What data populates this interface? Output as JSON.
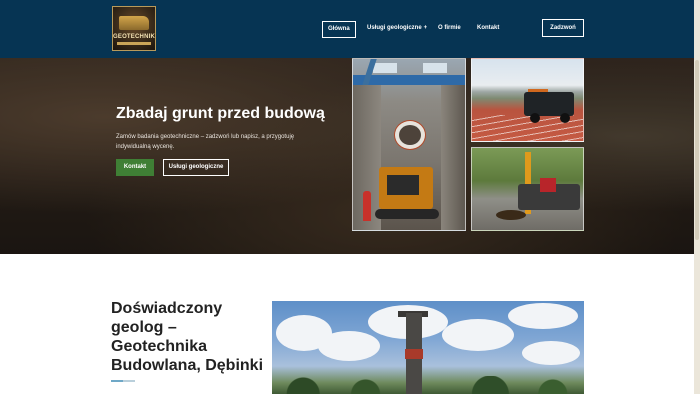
{
  "header": {
    "logo_text": "GEOTECHNIKA",
    "nav": [
      {
        "label": "Główna",
        "active": true
      },
      {
        "label": "Usługi geologiczne",
        "has_dropdown": true
      },
      {
        "label": "O firmie"
      },
      {
        "label": "Kontakt"
      }
    ],
    "call_button": "Zadzwoń",
    "background_color": "#063453"
  },
  "hero": {
    "title": "Zbadaj grunt przed budową",
    "description": "Zamów badania geotechniczne – zadzwoń lub napisz, a przygotuję indywidualną wycenę.",
    "primary_button": "Kontakt",
    "secondary_button": "Usługi geologiczne",
    "primary_color": "#3f7f35"
  },
  "section": {
    "title": "Doświadczony geolog – Geotechnika Budowlana, Dębinki"
  }
}
